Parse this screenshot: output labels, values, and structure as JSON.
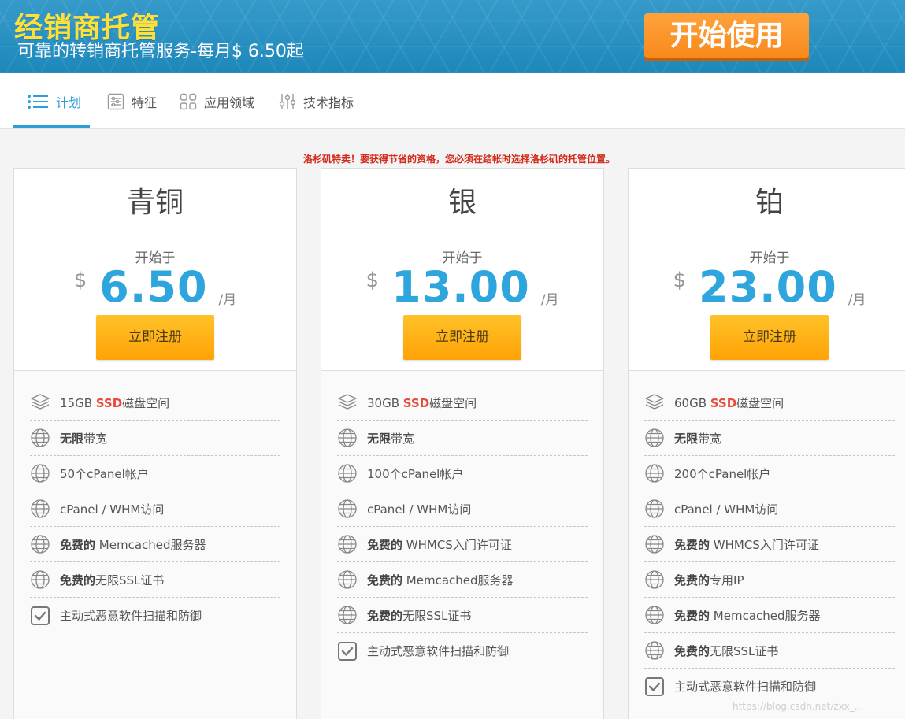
{
  "banner": {
    "title": "经销商托管",
    "subtitle": "可靠的转销商托管服务-每月$ 6.50起",
    "cta": "开始使用"
  },
  "tabs": [
    {
      "label": "计划",
      "icon": "list-icon",
      "active": true
    },
    {
      "label": "特征",
      "icon": "settings-list-icon",
      "active": false
    },
    {
      "label": "应用领域",
      "icon": "grid-icon",
      "active": false
    },
    {
      "label": "技术指标",
      "icon": "sliders-icon",
      "active": false
    }
  ],
  "promo": "洛杉矶特卖！要获得节省的资格，您必须在结帐时选择洛杉矶的托管位置。",
  "plans": [
    {
      "name": "青铜",
      "starts_label": "开始于",
      "currency": "$",
      "price": "6.50",
      "period": "/月",
      "button": "立即注册",
      "features": [
        {
          "icon": "layers-icon",
          "parts": [
            "15GB ",
            "SSD",
            "磁盘空间"
          ]
        },
        {
          "icon": "globe-icon",
          "parts": [
            "无限",
            "带宽"
          ]
        },
        {
          "icon": "globe-icon",
          "parts": [
            "50个cPanel帐户"
          ]
        },
        {
          "icon": "globe-icon",
          "parts": [
            "cPanel / WHM访问"
          ]
        },
        {
          "icon": "globe-icon",
          "parts": [
            "免费的",
            " Memcached服务器"
          ]
        },
        {
          "icon": "globe-icon",
          "parts": [
            "免费的",
            "无限SSL证书"
          ]
        },
        {
          "icon": "checkbox-icon",
          "parts": [
            "主动式恶意软件扫描和防御"
          ]
        }
      ]
    },
    {
      "name": "银",
      "starts_label": "开始于",
      "currency": "$",
      "price": "13.00",
      "period": "/月",
      "button": "立即注册",
      "features": [
        {
          "icon": "layers-icon",
          "parts": [
            "30GB ",
            "SSD",
            "磁盘空间"
          ]
        },
        {
          "icon": "globe-icon",
          "parts": [
            "无限",
            "带宽"
          ]
        },
        {
          "icon": "globe-icon",
          "parts": [
            "100个cPanel帐户"
          ]
        },
        {
          "icon": "globe-icon",
          "parts": [
            "cPanel / WHM访问"
          ]
        },
        {
          "icon": "globe-icon",
          "parts": [
            "免费的",
            " WHMCS入门许可证"
          ]
        },
        {
          "icon": "globe-icon",
          "parts": [
            "免费的",
            " Memcached服务器"
          ]
        },
        {
          "icon": "globe-icon",
          "parts": [
            "免费的",
            "无限SSL证书"
          ]
        },
        {
          "icon": "checkbox-icon",
          "parts": [
            "主动式恶意软件扫描和防御"
          ]
        }
      ]
    },
    {
      "name": "铂",
      "starts_label": "开始于",
      "currency": "$",
      "price": "23.00",
      "period": "/月",
      "button": "立即注册",
      "features": [
        {
          "icon": "layers-icon",
          "parts": [
            "60GB ",
            "SSD",
            "磁盘空间"
          ]
        },
        {
          "icon": "globe-icon",
          "parts": [
            "无限",
            "带宽"
          ]
        },
        {
          "icon": "globe-icon",
          "parts": [
            "200个cPanel帐户"
          ]
        },
        {
          "icon": "globe-icon",
          "parts": [
            "cPanel / WHM访问"
          ]
        },
        {
          "icon": "globe-icon",
          "parts": [
            "免费的",
            " WHMCS入门许可证"
          ]
        },
        {
          "icon": "globe-icon",
          "parts": [
            "免费的",
            "专用IP"
          ]
        },
        {
          "icon": "globe-icon",
          "parts": [
            "免费的",
            " Memcached服务器"
          ]
        },
        {
          "icon": "globe-icon",
          "parts": [
            "免费的",
            "无限SSL证书"
          ]
        },
        {
          "icon": "checkbox-icon",
          "parts": [
            "主动式恶意软件扫描和防御"
          ]
        }
      ]
    }
  ],
  "watermark": "https://blog.csdn.net/zxx_..."
}
